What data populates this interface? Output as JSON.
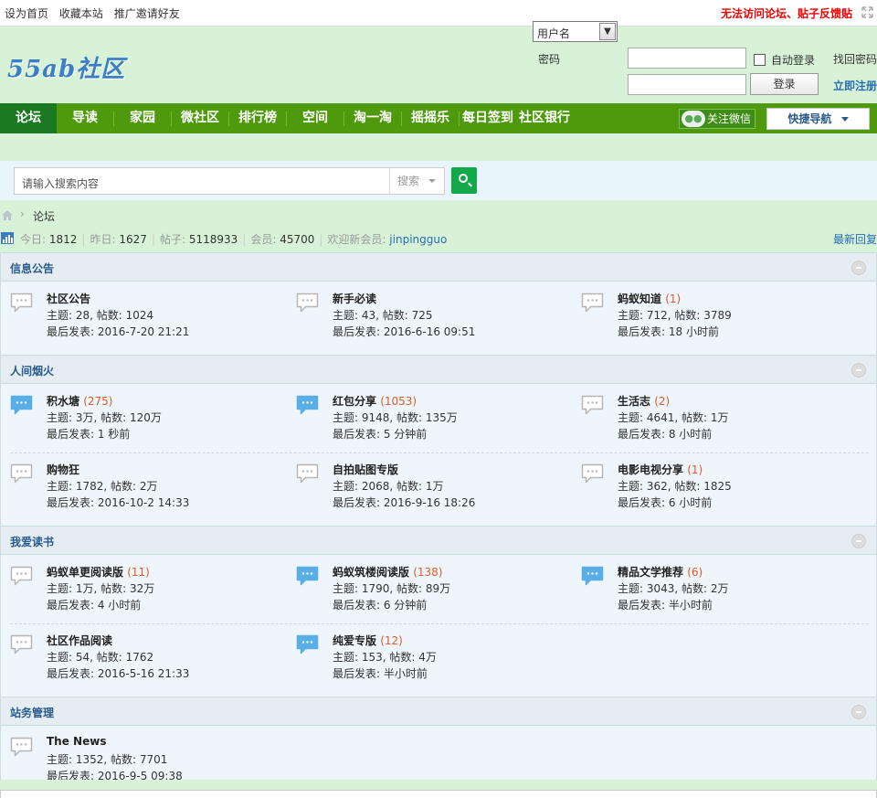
{
  "topbar": {
    "links": [
      "设为首页",
      "收藏本站",
      "推广邀请好友"
    ],
    "alert": "无法访问论坛、贴子反馈贴"
  },
  "header": {
    "logo_text": "55ab社区",
    "username_select": "用户名",
    "password_label": "密码",
    "auto_login": "自动登录",
    "login_button": "登录",
    "find_password": "找回密码",
    "register": "立即注册"
  },
  "nav": {
    "items": [
      "论坛",
      "导读",
      "家园",
      "微社区",
      "排行榜",
      "空间",
      "淘一淘",
      "摇摇乐",
      "每日签到",
      "社区银行"
    ],
    "wechat": "关注微信",
    "quick_nav": "快捷导航"
  },
  "search": {
    "placeholder": "请输入搜索内容",
    "scope": "搜索"
  },
  "breadcrumb": {
    "current": "论坛"
  },
  "stats": {
    "today_label": "今日:",
    "today": "1812",
    "yesterday_label": "昨日:",
    "yesterday": "1627",
    "posts_label": "帖子:",
    "posts": "5118933",
    "members_label": "会员:",
    "members": "45700",
    "welcome_label": "欢迎新会员:",
    "newest_member": "jinpingguo",
    "latest_replies": "最新回复"
  },
  "categories": [
    {
      "title": "信息公告",
      "forums": [
        {
          "name": "社区公告",
          "new": "",
          "stat": "主题: 28, 帖数: 1024",
          "last": "最后发表: 2016-7-20 21:21",
          "active": false
        },
        {
          "name": "新手必读",
          "new": "",
          "stat": "主题: 43, 帖数: 725",
          "last": "最后发表: 2016-6-16 09:51",
          "active": false
        },
        {
          "name": "蚂蚁知道",
          "new": "(1)",
          "stat": "主题: 712, 帖数: 3789",
          "last": "最后发表: 18 小时前",
          "active": false
        }
      ]
    },
    {
      "title": "人间烟火",
      "forums": [
        {
          "name": "积水塘",
          "new": "(275)",
          "stat": "主题: 3万, 帖数: 120万",
          "last": "最后发表: 1 秒前",
          "active": true
        },
        {
          "name": "红包分享",
          "new": "(1053)",
          "stat": "主题: 9148, 帖数: 135万",
          "last": "最后发表: 5 分钟前",
          "active": true
        },
        {
          "name": "生活志",
          "new": "(2)",
          "stat": "主题: 4641, 帖数: 1万",
          "last": "最后发表: 8 小时前",
          "active": false
        },
        {
          "name": "购物狂",
          "new": "",
          "stat": "主题: 1782, 帖数: 2万",
          "last": "最后发表: 2016-10-2 14:33",
          "active": false
        },
        {
          "name": "自拍贴图专版",
          "new": "",
          "stat": "主题: 2068, 帖数: 1万",
          "last": "最后发表: 2016-9-16 18:26",
          "active": false
        },
        {
          "name": "电影电视分享",
          "new": "(1)",
          "stat": "主题: 362, 帖数: 1825",
          "last": "最后发表: 6 小时前",
          "active": false
        }
      ]
    },
    {
      "title": "我爱读书",
      "forums": [
        {
          "name": "蚂蚁单更阅读版",
          "new": "(11)",
          "stat": "主题: 1万, 帖数: 32万",
          "last": "最后发表: 4 小时前",
          "active": false
        },
        {
          "name": "蚂蚁筑楼阅读版",
          "new": "(138)",
          "stat": "主题: 1790, 帖数: 89万",
          "last": "最后发表: 6 分钟前",
          "active": true
        },
        {
          "name": "精品文学推荐",
          "new": "(6)",
          "stat": "主题: 3043, 帖数: 2万",
          "last": "最后发表: 半小时前",
          "active": true
        },
        {
          "name": "社区作品阅读",
          "new": "",
          "stat": "主题: 54, 帖数: 1762",
          "last": "最后发表: 2016-5-16 21:33",
          "active": false
        },
        {
          "name": "纯爱专版",
          "new": "(12)",
          "stat": "主题: 153, 帖数: 4万",
          "last": "最后发表: 半小时前",
          "active": true
        }
      ]
    },
    {
      "title": "站务管理",
      "forums": [
        {
          "name": "The News",
          "new": "",
          "stat": "主题: 1352, 帖数: 7701",
          "last": "最后发表: 2016-9-5 09:38",
          "active": false
        }
      ]
    }
  ],
  "colors": {
    "nav_green": "#4e9a0c",
    "nav_active": "#1b7a21",
    "header_bg": "#d8f2d8",
    "new_count": "#e2592a",
    "link_blue": "#2a6db5",
    "icon_active": "#5aaee8",
    "icon_inactive": "#b5b5b5"
  }
}
